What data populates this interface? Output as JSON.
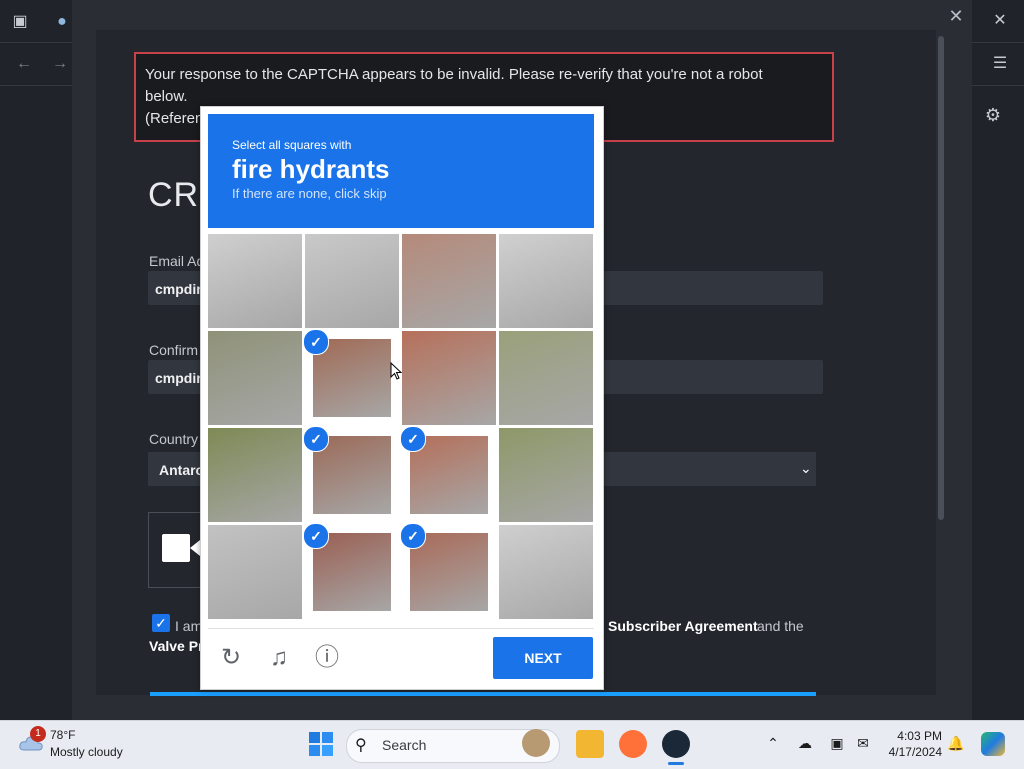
{
  "error": {
    "line1": "Your response to the CAPTCHA appears to be invalid. Please re-verify that you're not a robot",
    "line2": "below.",
    "line3": "(Referen"
  },
  "form": {
    "title": "CRE",
    "email_label": "Email Ad",
    "email_value": "cmpdir",
    "confirm_label": "Confirm",
    "confirm_value": "cmpdir",
    "country_label": "Country",
    "country_value": "Antarc",
    "agree_prefix": "I am",
    "subscriber_agreement": "Subscriber Agreement",
    "and_the": "and the",
    "valve_privacy": "Valve Pr"
  },
  "captcha": {
    "instruction_small": "Select all squares with",
    "target": "fire hydrants",
    "hint": "If there are none, click skip",
    "next_label": "NEXT",
    "tiles": [
      {
        "selected": false
      },
      {
        "selected": false
      },
      {
        "selected": false
      },
      {
        "selected": false
      },
      {
        "selected": false
      },
      {
        "selected": true
      },
      {
        "selected": false
      },
      {
        "selected": false
      },
      {
        "selected": false
      },
      {
        "selected": true
      },
      {
        "selected": true
      },
      {
        "selected": false
      },
      {
        "selected": false
      },
      {
        "selected": true
      },
      {
        "selected": true
      },
      {
        "selected": false
      }
    ]
  },
  "taskbar": {
    "weather_badge": "1",
    "temperature": "78°F",
    "condition": "Mostly cloudy",
    "search_placeholder": "Search",
    "time": "4:03 PM",
    "date": "4/17/2024"
  },
  "colors": {
    "accent": "#1a73e8",
    "error_border": "#c7414b",
    "steam_blue": "#1a9fff"
  }
}
